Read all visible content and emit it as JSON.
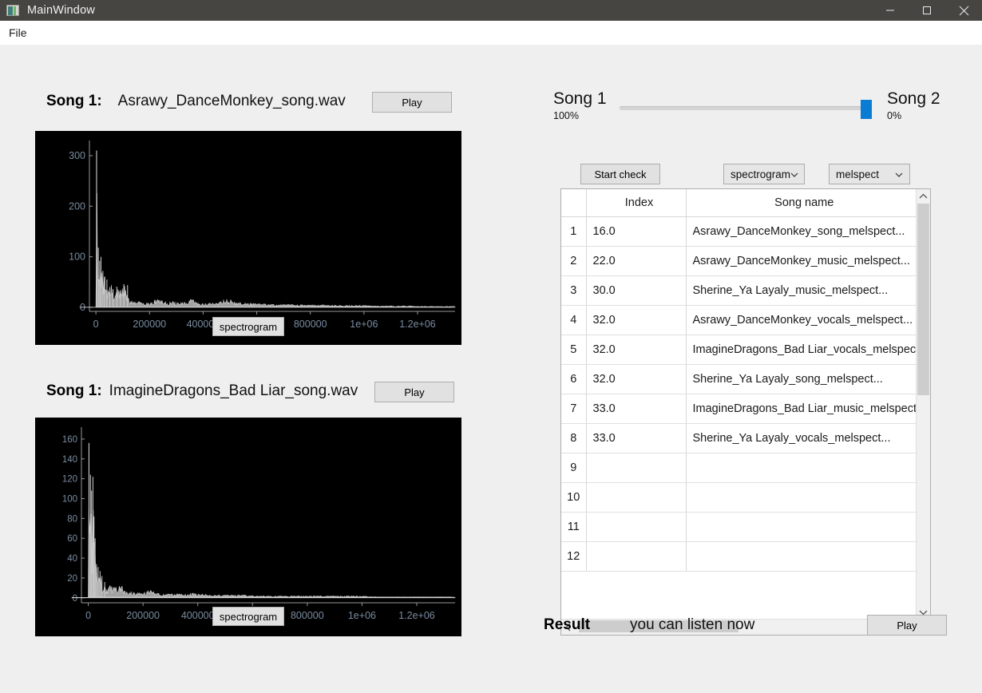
{
  "window": {
    "title": "MainWindow",
    "icon": "app-window-icon",
    "controls": {
      "minimize": "minimize-icon",
      "maximize": "maximize-icon",
      "close": "close-icon"
    },
    "titlebar_color": "#474542"
  },
  "menubar": {
    "items": [
      "File"
    ]
  },
  "songs": [
    {
      "label": "Song 1:",
      "filename": "Asrawy_DanceMonkey_song.wav",
      "play_label": "Play",
      "spectrogram_label": "spectrogram"
    },
    {
      "label": "Song 1:",
      "filename": "ImagineDragons_Bad Liar_song.wav",
      "play_label": "Play",
      "spectrogram_label": "spectrogram"
    }
  ],
  "mixer": {
    "left_name": "Song 1",
    "left_percent": "100%",
    "right_name": "Song 2",
    "right_percent": "0%",
    "handle_color": "#0a7cd4",
    "value": 100
  },
  "controls": {
    "start_check_label": "Start check",
    "mode_select": {
      "value": "spectrogram",
      "options": [
        "spectrogram"
      ]
    },
    "feature_select": {
      "value": "melspect",
      "options": [
        "melspect"
      ]
    }
  },
  "table": {
    "headers": [
      "",
      "Index",
      "Song name"
    ],
    "rows": [
      {
        "n": "1",
        "index": "16.0",
        "name": "Asrawy_DanceMonkey_song_melspect..."
      },
      {
        "n": "2",
        "index": "22.0",
        "name": "Asrawy_DanceMonkey_music_melspect..."
      },
      {
        "n": "3",
        "index": "30.0",
        "name": "Sherine_Ya Layaly_music_melspect..."
      },
      {
        "n": "4",
        "index": "32.0",
        "name": "Asrawy_DanceMonkey_vocals_melspect..."
      },
      {
        "n": "5",
        "index": "32.0",
        "name": "ImagineDragons_Bad Liar_vocals_melspec.."
      },
      {
        "n": "6",
        "index": "32.0",
        "name": "Sherine_Ya Layaly_song_melspect..."
      },
      {
        "n": "7",
        "index": "33.0",
        "name": "ImagineDragons_Bad Liar_music_melspect."
      },
      {
        "n": "8",
        "index": "33.0",
        "name": "Sherine_Ya Layaly_vocals_melspect..."
      },
      {
        "n": "9",
        "index": "",
        "name": ""
      },
      {
        "n": "10",
        "index": "",
        "name": ""
      },
      {
        "n": "11",
        "index": "",
        "name": ""
      },
      {
        "n": "12",
        "index": "",
        "name": ""
      }
    ],
    "scroll_up_icon": "chevron-up-icon",
    "scroll_down_icon": "chevron-down-icon",
    "scroll_left_icon": "chevron-left-icon",
    "scroll_right_icon": "chevron-right-icon"
  },
  "result": {
    "label": "Result",
    "text": "you can listen now",
    "play_label": "Play"
  },
  "chart_data": [
    {
      "type": "line",
      "title": "",
      "xlabel": "",
      "ylabel": "",
      "xlim": [
        -60000,
        1340000
      ],
      "ylim": [
        -8,
        330
      ],
      "xticks": [
        0,
        200000,
        400000,
        600000,
        800000,
        1000000,
        1200000
      ],
      "xticklabels": [
        "0",
        "200000",
        "400000",
        "600000",
        "800000",
        "1e+06",
        "1.2e+06"
      ],
      "yticks": [
        0,
        100,
        200,
        300
      ],
      "yticklabels": [
        "0",
        "100",
        "200",
        "300"
      ],
      "background": "#000000",
      "line_color": "#d0d0d0",
      "tick_color": "#7a8ca0",
      "grid": false,
      "legend": "none",
      "peak_value": 310,
      "x": [
        0,
        3000,
        6000,
        9000,
        12000,
        16000,
        20000,
        25000,
        30000,
        36000,
        42000,
        50000,
        58000,
        66000,
        74000,
        82000,
        90000,
        98000,
        106000,
        114000,
        122000,
        130000,
        140000,
        155000,
        170000,
        190000,
        210000,
        230000,
        250000,
        265000,
        285000,
        310000,
        335000,
        360000,
        380000,
        400000,
        425000,
        450000,
        475000,
        500000,
        525000,
        555000,
        590000,
        630000,
        680000,
        730000,
        790000,
        850000,
        920000,
        1000000,
        1080000,
        1160000,
        1250000,
        1320000
      ],
      "y": [
        2,
        310,
        125,
        95,
        110,
        60,
        98,
        45,
        70,
        55,
        40,
        38,
        45,
        35,
        30,
        38,
        32,
        42,
        46,
        30,
        18,
        14,
        12,
        11,
        12,
        10,
        11,
        20,
        13,
        10,
        12,
        9,
        10,
        18,
        9,
        8,
        9,
        10,
        17,
        16,
        10,
        9,
        8,
        7,
        6,
        6,
        5,
        5,
        4,
        4,
        3,
        3,
        2,
        2
      ]
    },
    {
      "type": "line",
      "title": "",
      "xlabel": "",
      "ylabel": "",
      "xlim": [
        -60000,
        1340000
      ],
      "ylim": [
        -5,
        172
      ],
      "xticks": [
        0,
        200000,
        400000,
        600000,
        800000,
        1000000,
        1200000
      ],
      "xticklabels": [
        "0",
        "200000",
        "400000",
        "600000",
        "800000",
        "1e+06",
        "1.2e+06"
      ],
      "yticks": [
        0,
        20,
        40,
        60,
        80,
        100,
        120,
        140,
        160
      ],
      "yticklabels": [
        "0",
        "20",
        "40",
        "60",
        "80",
        "100",
        "120",
        "140",
        "160"
      ],
      "background": "#000000",
      "line_color": "#d0d0d0",
      "tick_color": "#7a8ca0",
      "grid": false,
      "legend": "none",
      "peak_value": 156,
      "x": [
        0,
        2500,
        5000,
        8000,
        11000,
        14000,
        18000,
        22000,
        27000,
        32000,
        38000,
        44000,
        52000,
        60000,
        70000,
        80000,
        92000,
        105000,
        120000,
        135000,
        150000,
        165000,
        180000,
        200000,
        220000,
        240000,
        255000,
        275000,
        300000,
        330000,
        360000,
        390000,
        420000,
        450000,
        490000,
        530000,
        580000,
        630000,
        690000,
        750000,
        820000,
        900000,
        980000,
        1060000,
        1140000,
        1230000,
        1320000
      ],
      "y": [
        1,
        156,
        105,
        110,
        124,
        60,
        122,
        82,
        35,
        32,
        30,
        22,
        14,
        12,
        10,
        13,
        11,
        12,
        13,
        10,
        7,
        6,
        5,
        5,
        9,
        6,
        5,
        4,
        4,
        4,
        4,
        5,
        4,
        3,
        3,
        3,
        3,
        2,
        2,
        2,
        2,
        2,
        2,
        1,
        1,
        1,
        1
      ]
    }
  ]
}
